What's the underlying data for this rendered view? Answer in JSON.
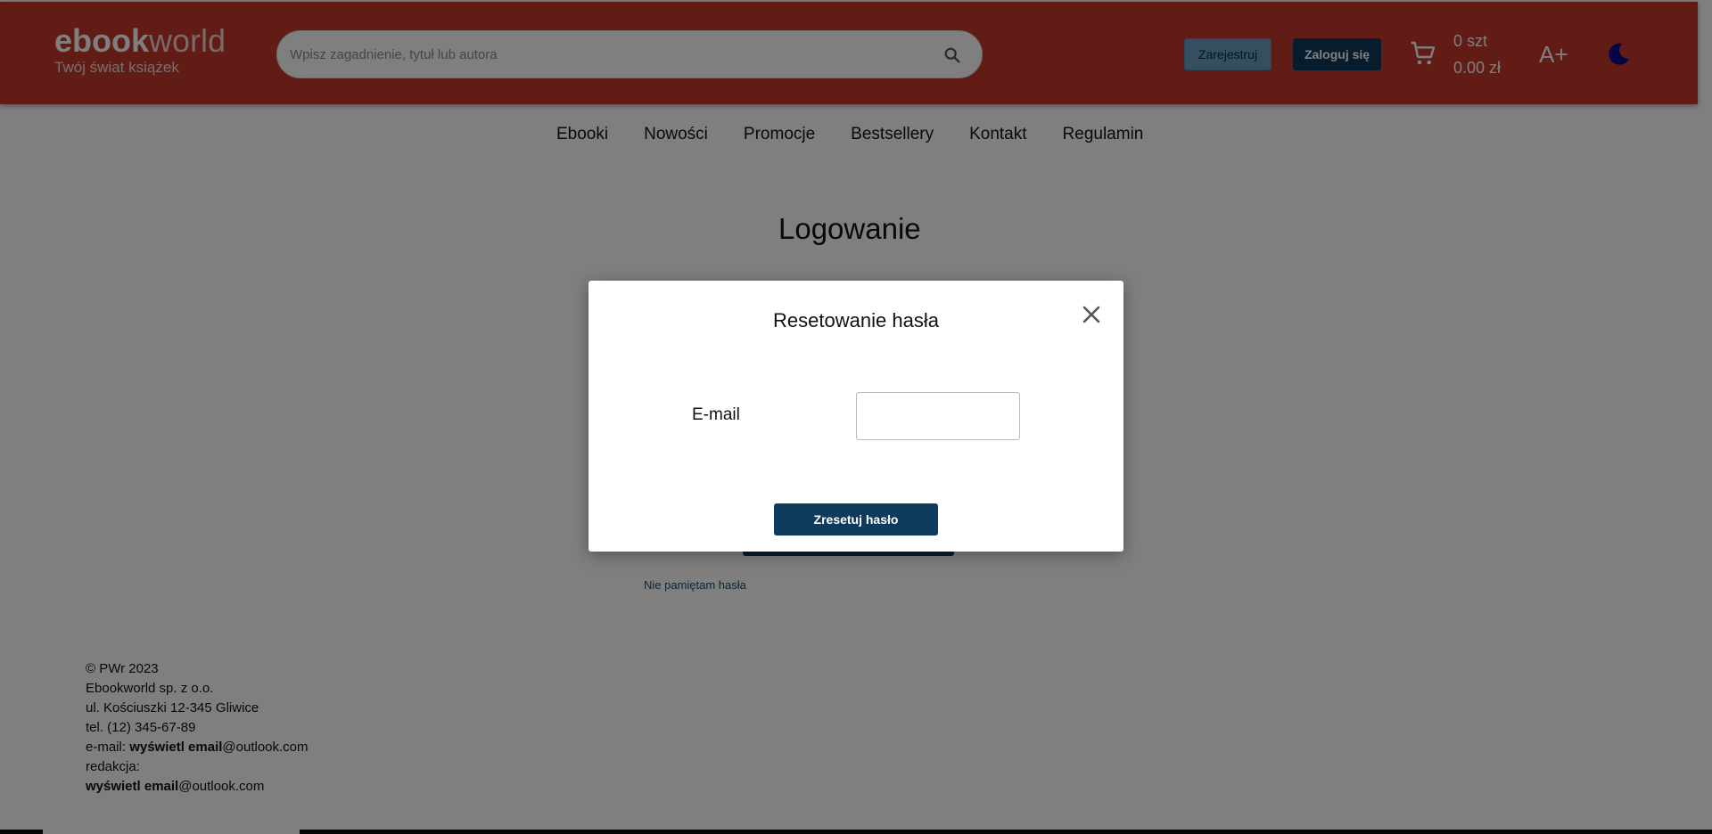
{
  "header": {
    "logo_bold": "ebook",
    "logo_light": "world",
    "tagline": "Twój świat książek",
    "search_placeholder": "Wpisz zagadnienie, tytuł lub autora",
    "register_label": "Zarejestruj",
    "login_label": "Zaloguj się",
    "cart_qty": "0 szt",
    "cart_total": "0.00 zł",
    "font_size_label": "A+",
    "colors": {
      "bar": "#c0392b",
      "register_btn": "#6b9fc2",
      "login_btn": "#0e3a5c",
      "moon": "#0a0a8c"
    }
  },
  "nav": {
    "items": [
      "Ebooki",
      "Nowości",
      "Promocje",
      "Bestsellery",
      "Kontakt",
      "Regulamin"
    ]
  },
  "main": {
    "title": "Logowanie",
    "forgot_password": "Nie pamiętam hasła"
  },
  "footer": {
    "copyright": "© PWr 2023",
    "company": "Ebookworld sp. z o.o.",
    "address": "ul. Kościuszki 12-345 Gliwice",
    "phone": "tel. (12) 345-67-89",
    "email_prefix": "e-mail: ",
    "email_bold": "wyświetl email",
    "email_domain": "@outlook.com",
    "editorial_label": "redakcja:",
    "editorial_bold": "wyświetl email",
    "editorial_domain": "@outlook.com"
  },
  "modal": {
    "title": "Resetowanie hasła",
    "email_label": "E-mail",
    "email_value": "",
    "submit_label": "Zresetuj hasło"
  }
}
